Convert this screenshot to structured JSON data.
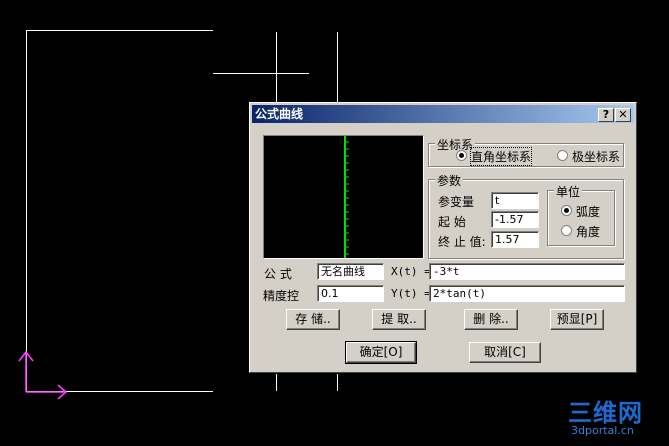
{
  "dialog": {
    "title": "公式曲线",
    "help_label": "?",
    "close_label": "✕",
    "coord_group": {
      "label": "坐标系",
      "options": [
        "直角坐标系",
        "极坐标系"
      ],
      "selected": "直角坐标系"
    },
    "param_group": {
      "label": "参数",
      "var_label": "参变量",
      "var_value": "t",
      "start_label": "起 始",
      "start_value": "-1.57",
      "end_label": "终 止 值:",
      "end_value": "1.57"
    },
    "unit_group": {
      "label": "单位",
      "options": [
        "弧度",
        "角度"
      ],
      "selected": "弧度"
    },
    "formula_label": "公 式",
    "formula_value": "无名曲线",
    "precision_label": "精度控",
    "precision_value": "0.1",
    "x_label": "X(t) =",
    "x_value": "-3*t",
    "y_label": "Y(t) =",
    "y_value": "2*tan(t)",
    "buttons": {
      "save": "存 储..",
      "extract": "提 取..",
      "delete": "删 除..",
      "preview": "预显[P]",
      "ok": "确定[O]",
      "cancel": "取消[C]"
    }
  },
  "watermark": {
    "brand": "三维网",
    "domain": "3dportal.cn"
  },
  "colors": {
    "curve": "#00e000",
    "axis_y": "#ff40ff",
    "titlebar_start": "#0a246a",
    "titlebar_end": "#a6caf0"
  }
}
